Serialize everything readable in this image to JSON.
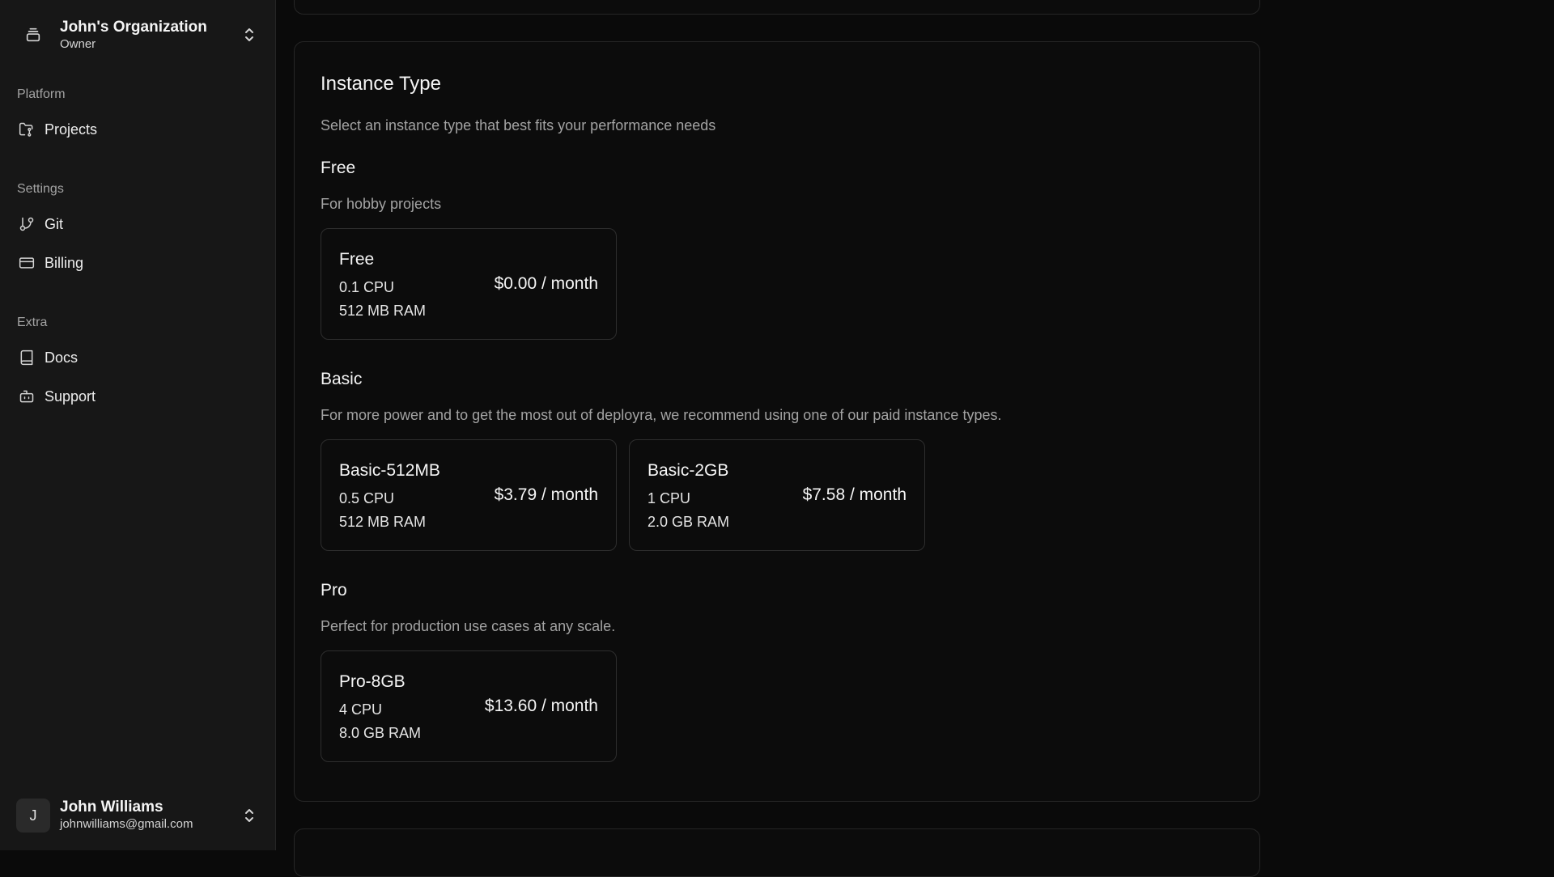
{
  "org": {
    "name": "John's Organization",
    "role": "Owner"
  },
  "sidebar": {
    "sections": [
      {
        "label": "Platform",
        "items": [
          {
            "label": "Projects",
            "icon": "folder-git-icon"
          }
        ]
      },
      {
        "label": "Settings",
        "items": [
          {
            "label": "Git",
            "icon": "git-branch-icon"
          },
          {
            "label": "Billing",
            "icon": "credit-card-icon"
          }
        ]
      },
      {
        "label": "Extra",
        "items": [
          {
            "label": "Docs",
            "icon": "book-icon"
          },
          {
            "label": "Support",
            "icon": "bot-icon"
          }
        ]
      }
    ]
  },
  "user": {
    "initial": "J",
    "name": "John Williams",
    "email": "johnwilliams@gmail.com"
  },
  "instance": {
    "title": "Instance Type",
    "description": "Select an instance type that best fits your performance needs",
    "tiers": [
      {
        "title": "Free",
        "description": "For hobby projects",
        "options": [
          {
            "name": "Free",
            "cpu": "0.1 CPU",
            "ram": "512 MB RAM",
            "price": "$0.00 / month"
          }
        ]
      },
      {
        "title": "Basic",
        "description": "For more power and to get the most out of deployra, we recommend using one of our paid instance types.",
        "options": [
          {
            "name": "Basic-512MB",
            "cpu": "0.5 CPU",
            "ram": "512 MB RAM",
            "price": "$3.79 / month"
          },
          {
            "name": "Basic-2GB",
            "cpu": "1 CPU",
            "ram": "2.0 GB RAM",
            "price": "$7.58 / month"
          }
        ]
      },
      {
        "title": "Pro",
        "description": "Perfect for production use cases at any scale.",
        "options": [
          {
            "name": "Pro-8GB",
            "cpu": "4 CPU",
            "ram": "8.0 GB RAM",
            "price": "$13.60 / month"
          }
        ]
      }
    ]
  }
}
